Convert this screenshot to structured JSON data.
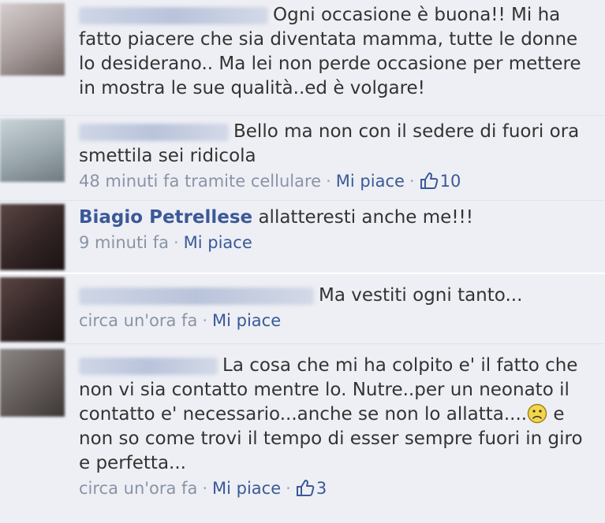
{
  "comments": [
    {
      "author": "",
      "text": "Ogni occasione è buona!! Mi ha fatto piacere che sia diventata mamma, tutte le donne lo desiderano.. Ma lei non perde occasione per mettere in mostra le sue qualità..ed è volgare!"
    },
    {
      "author": "",
      "text": "Bello ma non con il sedere di fuori ora smettila sei ridicola",
      "time": "48 minuti fa tramite cellulare",
      "like_label": "Mi piace",
      "likes": "10"
    },
    {
      "author": "Biagio Petrellese",
      "text": "allatteresti anche me!!!",
      "time": "9 minuti fa",
      "like_label": "Mi piace"
    },
    {
      "author": "",
      "text": "Ma vestiti ogni tanto...",
      "time": "circa un'ora fa",
      "like_label": "Mi piace"
    },
    {
      "author": "",
      "text_a": "La cosa che mi ha colpito e' il fatto che non vi sia contatto mentre lo. Nutre..per un neonato il contatto e' necessario...anche se non lo allatta....",
      "text_b": "e non so come trovi il tempo di esser sempre fuori in giro e perfetta...",
      "time": "circa un'ora fa",
      "like_label": "Mi piace",
      "likes": "3"
    }
  ],
  "icons": {
    "like": "thumbs-up-icon",
    "emoticon": "sad-face-icon"
  },
  "colors": {
    "link": "#3b5998",
    "meta": "#8a93a6",
    "background": "#edeff4"
  }
}
